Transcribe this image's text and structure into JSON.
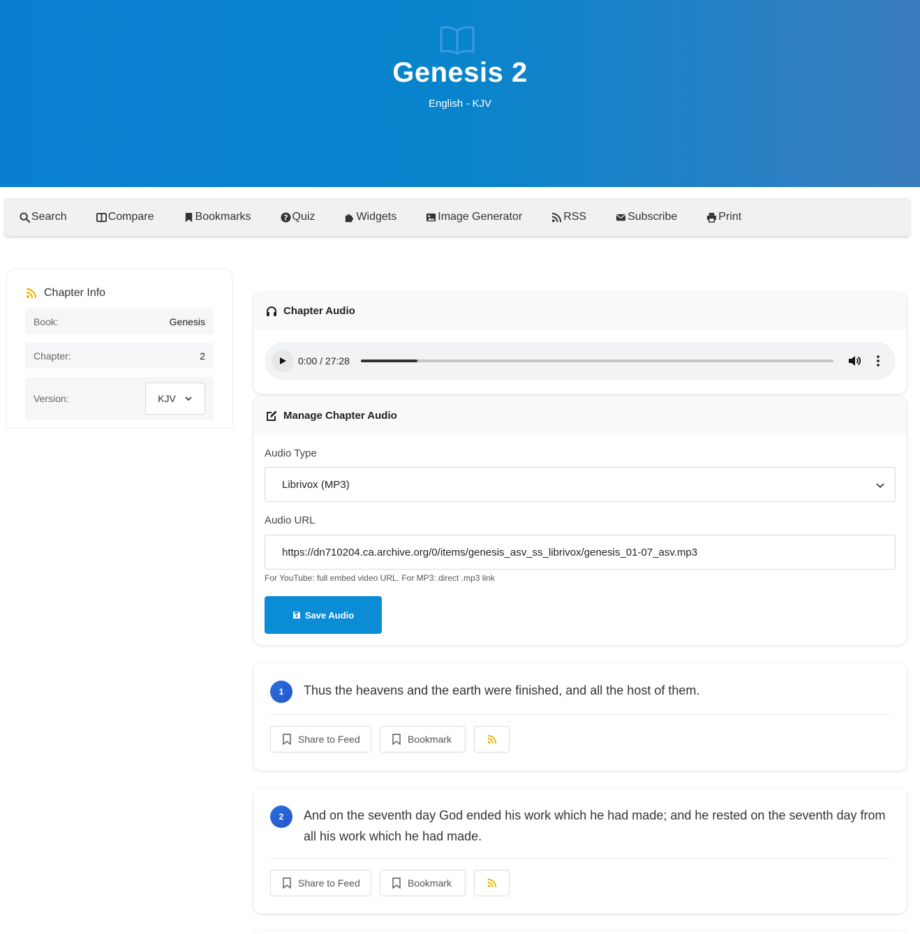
{
  "hero": {
    "title": "Genesis 2",
    "subtitle": "English - KJV"
  },
  "nav": [
    {
      "label": "Search",
      "icon": "search-icon"
    },
    {
      "label": "Compare",
      "icon": "columns-icon"
    },
    {
      "label": "Bookmarks",
      "icon": "bookmark-icon"
    },
    {
      "label": "Quiz",
      "icon": "question-icon"
    },
    {
      "label": "Widgets",
      "icon": "puzzle-icon"
    },
    {
      "label": "Image Generator",
      "icon": "image-icon"
    },
    {
      "label": "RSS",
      "icon": "rss-icon"
    },
    {
      "label": "Subscribe",
      "icon": "envelope-icon"
    },
    {
      "label": "Print",
      "icon": "printer-icon"
    }
  ],
  "sidebar": {
    "title": "Chapter Info",
    "book_label": "Book:",
    "book_value": "Genesis",
    "chapter_label": "Chapter:",
    "chapter_value": "2",
    "version_label": "Version:",
    "version_value": "KJV"
  },
  "audio": {
    "title": "Chapter Audio",
    "time": "0:00 / 27:28",
    "progress_fraction": 0.12
  },
  "manage": {
    "title": "Manage Chapter Audio",
    "type_label": "Audio Type",
    "type_value": "Librivox (MP3)",
    "url_label": "Audio URL",
    "url_value": "https://dn710204.ca.archive.org/0/items/genesis_asv_ss_librivox/genesis_01-07_asv.mp3",
    "help": "For YouTube: full embed video URL. For MP3: direct .mp3 link",
    "save_label": "Save Audio"
  },
  "verses": [
    {
      "number": "1",
      "text": "Thus the heavens and the earth were finished, and all the host of them.",
      "share_label": "Share to Feed",
      "bookmark_label": "Bookmark"
    },
    {
      "number": "2",
      "text": "And on the seventh day God ended his work which he had made; and he rested on the seventh day from all his work which he had made.",
      "share_label": "Share to Feed",
      "bookmark_label": "Bookmark"
    }
  ],
  "colors": {
    "hero_start": "#0a7fd0",
    "hero_end": "#3a7dbe",
    "accent": "#0b8cd6",
    "rss": "#f0b400",
    "verse_badge": "#2a6fe0"
  }
}
